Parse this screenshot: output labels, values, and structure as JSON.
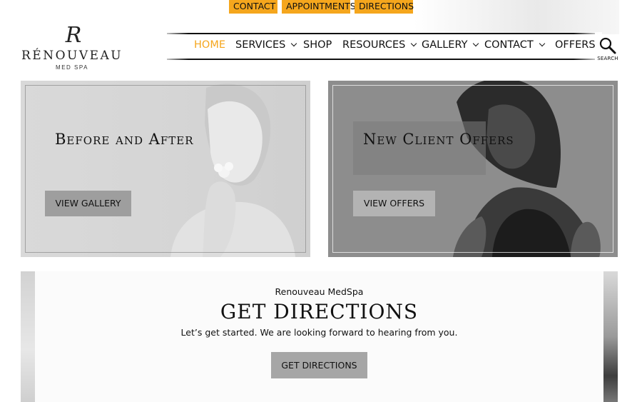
{
  "topbar": {
    "contact_label": "CONTACT",
    "appointments_label": "APPOINTMENTS",
    "directions_label": "DIRECTIONS",
    "accent_color": "#f5a61d"
  },
  "logo": {
    "mark": "R",
    "name": "RÉNOUVEAU",
    "sub": "MED SPA"
  },
  "nav": {
    "items": [
      {
        "label": "HOME",
        "active": true,
        "dropdown": false
      },
      {
        "label": "SERVICES",
        "active": false,
        "dropdown": true
      },
      {
        "label": "SHOP",
        "active": false,
        "dropdown": false
      },
      {
        "label": "RESOURCES",
        "active": false,
        "dropdown": true
      },
      {
        "label": "GALLERY",
        "active": false,
        "dropdown": true
      },
      {
        "label": "CONTACT",
        "active": false,
        "dropdown": true
      },
      {
        "label": "OFFERS",
        "active": false,
        "dropdown": false
      }
    ],
    "search_icon": "search-icon",
    "search_label": "SEARCH"
  },
  "hero": {
    "left": {
      "title": "Before and After",
      "button_label": "VIEW GALLERY"
    },
    "right": {
      "title": "New Client Offers",
      "button_label": "VIEW OFFERS"
    }
  },
  "directions": {
    "kicker": "Renouveau MedSpa",
    "title": "GET DIRECTIONS",
    "text": "Let’s get started. We are looking forward to hearing from you.",
    "button_label": "GET DIRECTIONS"
  }
}
